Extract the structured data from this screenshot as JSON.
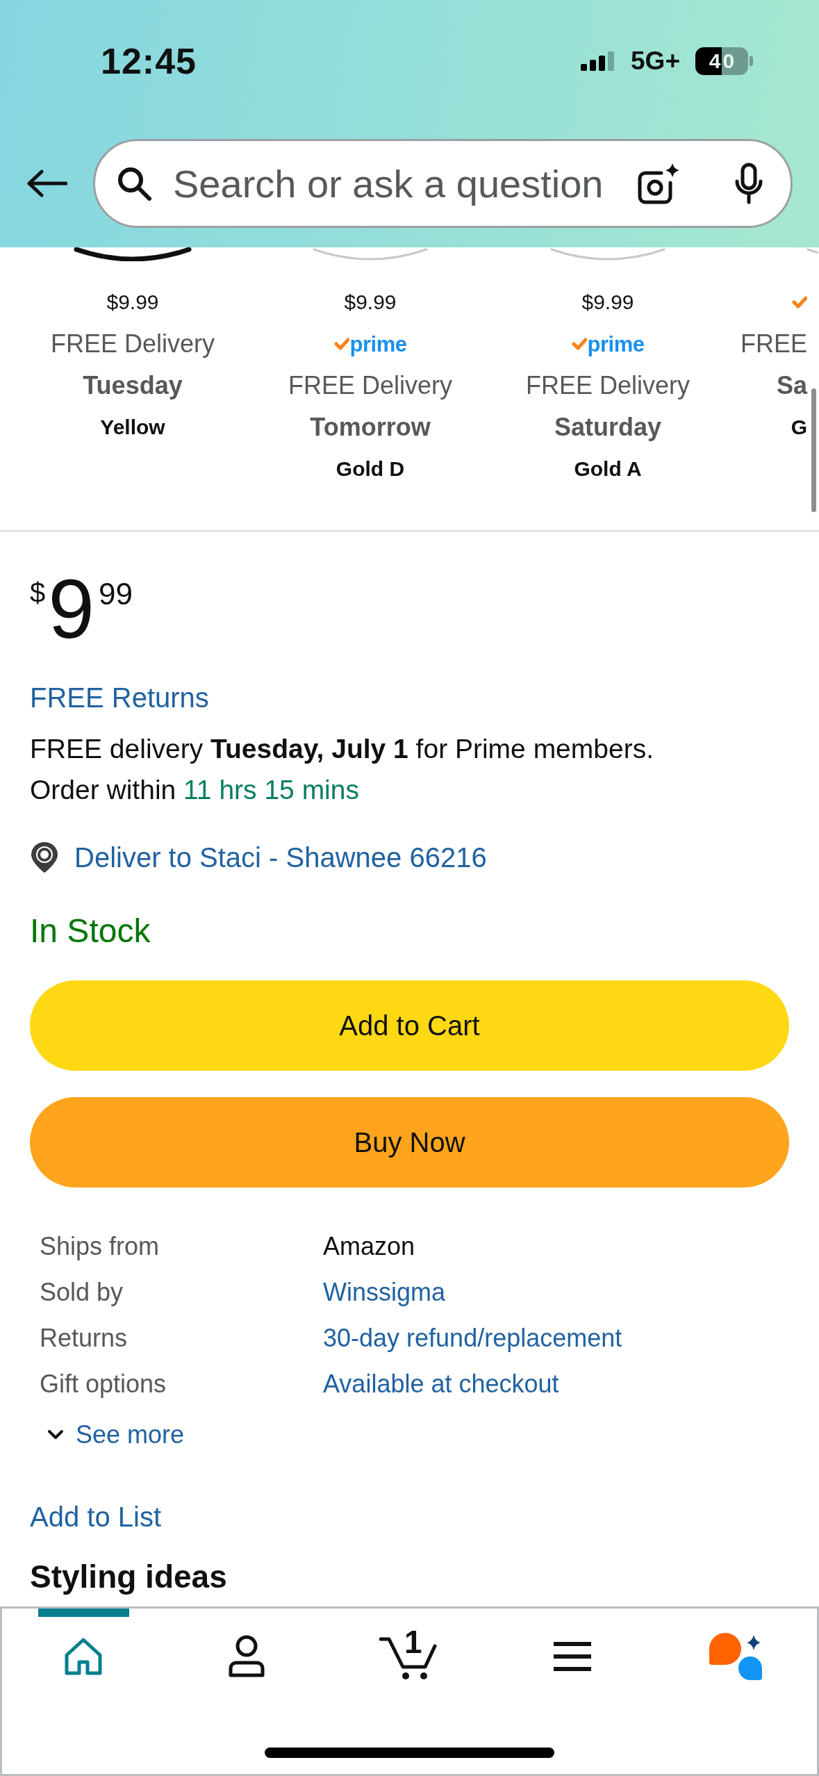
{
  "status_bar": {
    "time": "12:45",
    "network": "5G+",
    "battery": "40"
  },
  "search": {
    "placeholder": "Search or ask a question"
  },
  "variants": [
    {
      "selected": true,
      "price": "$9.99",
      "prime": false,
      "delivery": "FREE Delivery",
      "day": "Tuesday",
      "name": "Yellow"
    },
    {
      "selected": false,
      "price": "$9.99",
      "prime": true,
      "badge": "prime",
      "delivery": "FREE Delivery",
      "day": "Tomorrow",
      "name": "Gold D"
    },
    {
      "selected": false,
      "price": "$9.99",
      "prime": true,
      "badge": "prime",
      "delivery": "FREE Delivery",
      "day": "Saturday",
      "name": "Gold A"
    },
    {
      "selected": false,
      "prime": true,
      "delivery": "FREE",
      "day": "Sa",
      "name": "G"
    }
  ],
  "price": {
    "symbol": "$",
    "whole": "9",
    "fraction": "99"
  },
  "returns_link": "FREE Returns",
  "delivery": {
    "message": "FREE delivery **Tuesday, July 1** for Prime members.",
    "order_within": "Order within",
    "countdown": "11 hrs 15 mins"
  },
  "deliver_to": "Deliver to Staci - Shawnee 66216",
  "availability": "In Stock",
  "buttons": [
    {
      "kind": "cart",
      "label": "Add to Cart"
    },
    {
      "kind": "buy",
      "label": "Buy Now"
    }
  ],
  "details": [
    {
      "label": "Ships from",
      "value": "Amazon",
      "link": false
    },
    {
      "label": "Sold by",
      "value": "Winssigma",
      "link": true
    },
    {
      "label": "Returns",
      "value": "30-day refund/replacement",
      "link": true
    },
    {
      "label": "Gift options",
      "value": "Available at checkout",
      "link": true
    }
  ],
  "see_more": {
    "label": "See more",
    "expanded": false
  },
  "add_to_list": "Add to List",
  "section_heading": "Styling ideas",
  "tab_bar": {
    "tabs": [
      {
        "kind": "home",
        "selected": true
      },
      {
        "kind": "account",
        "selected": false
      },
      {
        "kind": "cart",
        "selected": false,
        "count": "1"
      },
      {
        "kind": "menu",
        "selected": false
      },
      {
        "kind": "assistant",
        "selected": false
      }
    ]
  }
}
